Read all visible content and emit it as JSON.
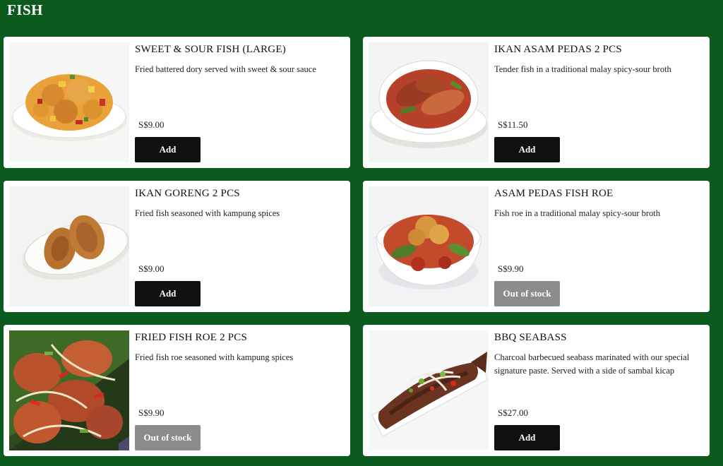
{
  "section": {
    "title": "FISH"
  },
  "items": [
    {
      "name": "SWEET & SOUR FISH (LARGE)",
      "description": "Fried battered dory served with sweet & sour sauce",
      "price": "S$9.00",
      "button_label": "Add",
      "in_stock": true,
      "image": "sweet-sour-fish-photo"
    },
    {
      "name": "IKAN ASAM PEDAS 2 PCS",
      "description": "Tender fish in a traditional malay spicy-sour broth",
      "price": "S$11.50",
      "button_label": "Add",
      "in_stock": true,
      "image": "ikan-asam-pedas-photo"
    },
    {
      "name": "IKAN GORENG 2 PCS",
      "description": "Fried fish seasoned with kampung spices",
      "price": "S$9.00",
      "button_label": "Add",
      "in_stock": true,
      "image": "ikan-goreng-photo"
    },
    {
      "name": "ASAM PEDAS FISH ROE",
      "description": "Fish roe in a traditional malay spicy-sour broth",
      "price": "S$9.90",
      "button_label": "Out of stock",
      "in_stock": false,
      "image": "asam-pedas-fish-roe-photo"
    },
    {
      "name": "FRIED FISH ROE 2 PCS",
      "description": "Fried fish roe seasoned with kampung spices",
      "price": "S$9.90",
      "button_label": "Out of stock",
      "in_stock": false,
      "image": "fried-fish-roe-photo"
    },
    {
      "name": "BBQ SEABASS",
      "description": "Charcoal barbecued seabass marinated with our special signature paste. Served with a side of sambal kicap",
      "price": "S$27.00",
      "button_label": "Add",
      "in_stock": true,
      "image": "bbq-seabass-photo"
    }
  ],
  "colors": {
    "page_background": "#0b5a1e",
    "card_background": "#ffffff",
    "add_button": "#111111",
    "out_of_stock_button": "#8c8c8c"
  }
}
